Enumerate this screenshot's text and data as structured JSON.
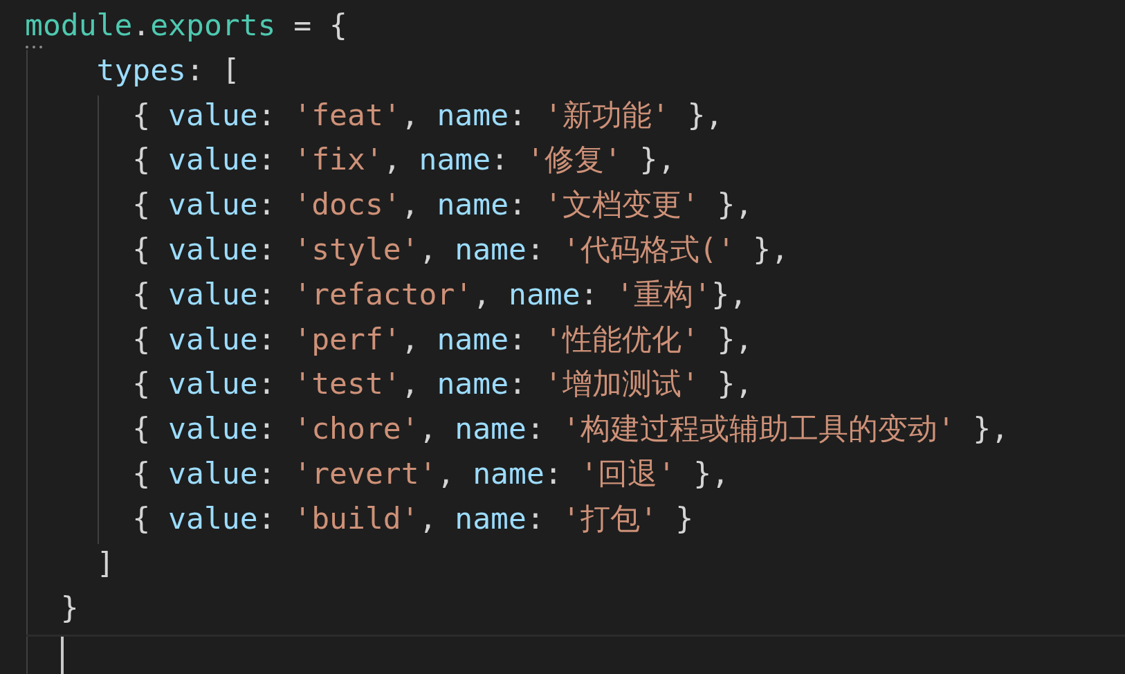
{
  "editor": {
    "lines": [
      {
        "tokens": [
          {
            "kind": "type",
            "text": "module"
          },
          {
            "kind": "punct",
            "text": "."
          },
          {
            "kind": "type",
            "text": "exports"
          },
          {
            "kind": "punct",
            "text": " = {"
          }
        ]
      },
      {
        "tokens": [
          {
            "kind": "key",
            "text": "    types"
          },
          {
            "kind": "punct",
            "text": ": ["
          }
        ]
      },
      {
        "tokens": [
          {
            "kind": "punct",
            "text": "      { "
          },
          {
            "kind": "key",
            "text": "value"
          },
          {
            "kind": "punct",
            "text": ": "
          },
          {
            "kind": "string",
            "text": "'feat'"
          },
          {
            "kind": "punct",
            "text": ", "
          },
          {
            "kind": "key",
            "text": "name"
          },
          {
            "kind": "punct",
            "text": ": "
          },
          {
            "kind": "string",
            "text": "'新功能'"
          },
          {
            "kind": "punct",
            "text": " },"
          }
        ]
      },
      {
        "tokens": [
          {
            "kind": "punct",
            "text": "      { "
          },
          {
            "kind": "key",
            "text": "value"
          },
          {
            "kind": "punct",
            "text": ": "
          },
          {
            "kind": "string",
            "text": "'fix'"
          },
          {
            "kind": "punct",
            "text": ", "
          },
          {
            "kind": "key",
            "text": "name"
          },
          {
            "kind": "punct",
            "text": ": "
          },
          {
            "kind": "string",
            "text": "'修复'"
          },
          {
            "kind": "punct",
            "text": " },"
          }
        ]
      },
      {
        "tokens": [
          {
            "kind": "punct",
            "text": "      { "
          },
          {
            "kind": "key",
            "text": "value"
          },
          {
            "kind": "punct",
            "text": ": "
          },
          {
            "kind": "string",
            "text": "'docs'"
          },
          {
            "kind": "punct",
            "text": ", "
          },
          {
            "kind": "key",
            "text": "name"
          },
          {
            "kind": "punct",
            "text": ": "
          },
          {
            "kind": "string",
            "text": "'文档变更'"
          },
          {
            "kind": "punct",
            "text": " },"
          }
        ]
      },
      {
        "tokens": [
          {
            "kind": "punct",
            "text": "      { "
          },
          {
            "kind": "key",
            "text": "value"
          },
          {
            "kind": "punct",
            "text": ": "
          },
          {
            "kind": "string",
            "text": "'style'"
          },
          {
            "kind": "punct",
            "text": ", "
          },
          {
            "kind": "key",
            "text": "name"
          },
          {
            "kind": "punct",
            "text": ": "
          },
          {
            "kind": "string",
            "text": "'代码格式('"
          },
          {
            "kind": "punct",
            "text": " },"
          }
        ]
      },
      {
        "tokens": [
          {
            "kind": "punct",
            "text": "      { "
          },
          {
            "kind": "key",
            "text": "value"
          },
          {
            "kind": "punct",
            "text": ": "
          },
          {
            "kind": "string",
            "text": "'refactor'"
          },
          {
            "kind": "punct",
            "text": ", "
          },
          {
            "kind": "key",
            "text": "name"
          },
          {
            "kind": "punct",
            "text": ": "
          },
          {
            "kind": "string",
            "text": "'重构'"
          },
          {
            "kind": "punct",
            "text": "},"
          }
        ]
      },
      {
        "tokens": [
          {
            "kind": "punct",
            "text": "      { "
          },
          {
            "kind": "key",
            "text": "value"
          },
          {
            "kind": "punct",
            "text": ": "
          },
          {
            "kind": "string",
            "text": "'perf'"
          },
          {
            "kind": "punct",
            "text": ", "
          },
          {
            "kind": "key",
            "text": "name"
          },
          {
            "kind": "punct",
            "text": ": "
          },
          {
            "kind": "string",
            "text": "'性能优化'"
          },
          {
            "kind": "punct",
            "text": " },"
          }
        ]
      },
      {
        "tokens": [
          {
            "kind": "punct",
            "text": "      { "
          },
          {
            "kind": "key",
            "text": "value"
          },
          {
            "kind": "punct",
            "text": ": "
          },
          {
            "kind": "string",
            "text": "'test'"
          },
          {
            "kind": "punct",
            "text": ", "
          },
          {
            "kind": "key",
            "text": "name"
          },
          {
            "kind": "punct",
            "text": ": "
          },
          {
            "kind": "string",
            "text": "'增加测试'"
          },
          {
            "kind": "punct",
            "text": " },"
          }
        ]
      },
      {
        "tokens": [
          {
            "kind": "punct",
            "text": "      { "
          },
          {
            "kind": "key",
            "text": "value"
          },
          {
            "kind": "punct",
            "text": ": "
          },
          {
            "kind": "string",
            "text": "'chore'"
          },
          {
            "kind": "punct",
            "text": ", "
          },
          {
            "kind": "key",
            "text": "name"
          },
          {
            "kind": "punct",
            "text": ": "
          },
          {
            "kind": "string",
            "text": "'构建过程或辅助工具的变动'"
          },
          {
            "kind": "punct",
            "text": " },"
          }
        ]
      },
      {
        "tokens": [
          {
            "kind": "punct",
            "text": "      { "
          },
          {
            "kind": "key",
            "text": "value"
          },
          {
            "kind": "punct",
            "text": ": "
          },
          {
            "kind": "string",
            "text": "'revert'"
          },
          {
            "kind": "punct",
            "text": ", "
          },
          {
            "kind": "key",
            "text": "name"
          },
          {
            "kind": "punct",
            "text": ": "
          },
          {
            "kind": "string",
            "text": "'回退'"
          },
          {
            "kind": "punct",
            "text": " },"
          }
        ]
      },
      {
        "tokens": [
          {
            "kind": "punct",
            "text": "      { "
          },
          {
            "kind": "key",
            "text": "value"
          },
          {
            "kind": "punct",
            "text": ": "
          },
          {
            "kind": "string",
            "text": "'build'"
          },
          {
            "kind": "punct",
            "text": ", "
          },
          {
            "kind": "key",
            "text": "name"
          },
          {
            "kind": "punct",
            "text": ": "
          },
          {
            "kind": "string",
            "text": "'打包'"
          },
          {
            "kind": "punct",
            "text": " }"
          }
        ]
      },
      {
        "tokens": [
          {
            "kind": "punct",
            "text": "    ]"
          }
        ]
      },
      {
        "tokens": [
          {
            "kind": "punct",
            "text": "  }"
          }
        ]
      }
    ]
  }
}
